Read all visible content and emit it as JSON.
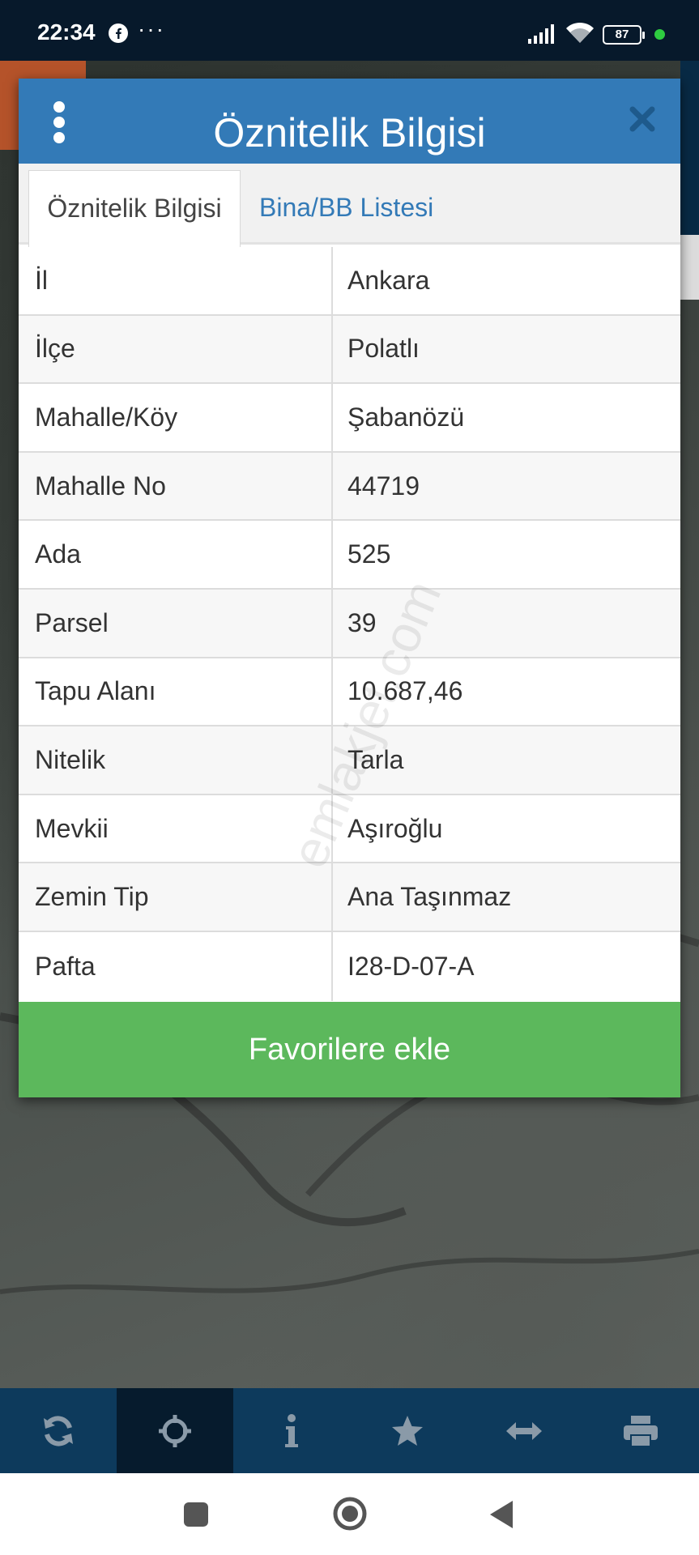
{
  "status_bar": {
    "time": "22:34",
    "dots": "···",
    "battery": "87"
  },
  "dialog": {
    "title": "Öznitelik Bilgisi",
    "tabs": [
      {
        "label": "Öznitelik Bilgisi",
        "active": true
      },
      {
        "label": "Bina/BB Listesi",
        "active": false
      }
    ],
    "rows": [
      {
        "key": "İl",
        "value": "Ankara"
      },
      {
        "key": "İlçe",
        "value": "Polatlı"
      },
      {
        "key": "Mahalle/Köy",
        "value": "Şabanözü"
      },
      {
        "key": "Mahalle No",
        "value": "44719"
      },
      {
        "key": "Ada",
        "value": "525"
      },
      {
        "key": "Parsel",
        "value": "39"
      },
      {
        "key": "Tapu Alanı",
        "value": "10.687,46"
      },
      {
        "key": "Nitelik",
        "value": "Tarla"
      },
      {
        "key": "Mevkii",
        "value": "Aşıroğlu"
      },
      {
        "key": "Zemin Tip",
        "value": "Ana Taşınmaz"
      },
      {
        "key": "Pafta",
        "value": "I28-D-07-A"
      }
    ],
    "favorite_label": "Favorilere ekle"
  },
  "watermark": "emlakjet.com",
  "toolbar": {
    "items": [
      "refresh-icon",
      "crosshair-icon",
      "info-icon",
      "star-icon",
      "arrows-horizontal-icon",
      "print-icon"
    ],
    "active_index": 1
  },
  "navbar": {
    "items": [
      "recents-icon",
      "home-icon",
      "back-icon"
    ]
  },
  "colors": {
    "header_blue": "#337ab7",
    "favorite_green": "#5cb85c",
    "toolbar_blue": "#0d3a5c",
    "status_bar": "#07192b"
  }
}
